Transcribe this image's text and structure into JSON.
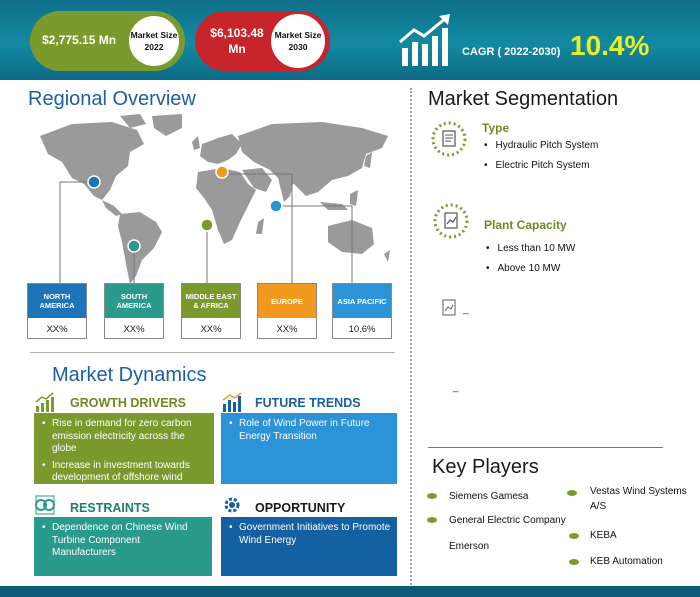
{
  "header": {
    "market_size_2022_value": "$2,775.15 Mn",
    "market_size_2022_label": "Market Size 2022",
    "market_size_2030_value": "$6,103.48 Mn",
    "market_size_2030_label": "Market Size 2030",
    "cagr_label": "CAGR ( 2022-2030)",
    "cagr_value": "10.4%"
  },
  "regional": {
    "title": "Regional Overview",
    "regions": [
      {
        "name": "NORTH AMERICA",
        "value": "XX%",
        "color": "#1d74b8"
      },
      {
        "name": "SOUTH AMERICA",
        "value": "XX%",
        "color": "#2a9a8c"
      },
      {
        "name": "MIDDLE EAST & AFRICA",
        "value": "XX%",
        "color": "#7a9a2e"
      },
      {
        "name": "EUROPE",
        "value": "XX%",
        "color": "#f19a1f"
      },
      {
        "name": "ASIA PACIFIC",
        "value": "10.6%",
        "color": "#2c93d6"
      }
    ]
  },
  "dynamics": {
    "title": "Market Dynamics",
    "growth_drivers": {
      "title": "GROWTH DRIVERS",
      "items": [
        "Rise in demand for zero carbon emission electricity across the globe",
        "Increase in investment towards development of offshore wind power plant in emerging regions"
      ]
    },
    "future_trends": {
      "title": "FUTURE TRENDS",
      "items": [
        "Role of Wind Power in Future Energy Transition"
      ]
    },
    "restraints": {
      "title": "RESTRAINTS",
      "items": [
        "Dependence on Chinese Wind Turbine Component Manufacturers"
      ]
    },
    "opportunity": {
      "title": "OPPORTUNITY",
      "items": [
        "Government Initiatives to Promote Wind Energy"
      ]
    }
  },
  "segmentation": {
    "title": "Market Segmentation",
    "type": {
      "title": "Type",
      "items": [
        "Hydraulic Pitch System",
        "Electric Pitch System"
      ]
    },
    "plant_capacity": {
      "title": "Plant Capacity",
      "items": [
        "Less than 10 MW",
        "Above 10 MW"
      ]
    },
    "third_marker": "_",
    "fourth_marker": "_"
  },
  "key_players": {
    "title": "Key Players",
    "players": [
      "Siemens Gamesa",
      "General Electric Company",
      "Emerson",
      "Vestas Wind Systems A/S",
      "KEBA",
      "KEB Automation"
    ]
  },
  "colors": {
    "header": "#0f6f8a",
    "green": "#7a9a2e",
    "teal": "#2a9a8c",
    "blue": "#2c93d6",
    "dark_blue": "#1560a0",
    "red": "#c8242c"
  }
}
